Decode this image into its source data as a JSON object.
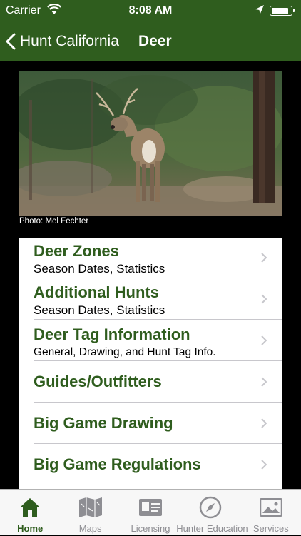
{
  "status_bar": {
    "carrier": "Carrier",
    "time": "8:08 AM",
    "battery_level": 0.9
  },
  "nav": {
    "back_label": "Hunt California",
    "title": "Deer"
  },
  "photo": {
    "credit": "Photo: Mel Fechter"
  },
  "menu": {
    "items": [
      {
        "title": "Deer Zones",
        "subtitle": "Season Dates, Statistics"
      },
      {
        "title": "Additional Hunts",
        "subtitle": "Season Dates, Statistics"
      },
      {
        "title": "Deer Tag Information",
        "subtitle": "General, Drawing, and Hunt Tag Info."
      },
      {
        "title": "Guides/Outfitters"
      },
      {
        "title": "Big Game Drawing"
      },
      {
        "title": "Big Game Regulations"
      }
    ]
  },
  "tabs": [
    {
      "label": "Home",
      "icon": "home-icon",
      "active": true
    },
    {
      "label": "Maps",
      "icon": "map-icon",
      "active": false
    },
    {
      "label": "Licensing",
      "icon": "license-card-icon",
      "active": false
    },
    {
      "label": "Hunter Education",
      "icon": "compass-icon",
      "active": false
    },
    {
      "label": "Services",
      "icon": "photo-icon",
      "active": false
    }
  ],
  "colors": {
    "brand_green": "#2f5d1e",
    "tab_inactive": "#8e8e93"
  }
}
